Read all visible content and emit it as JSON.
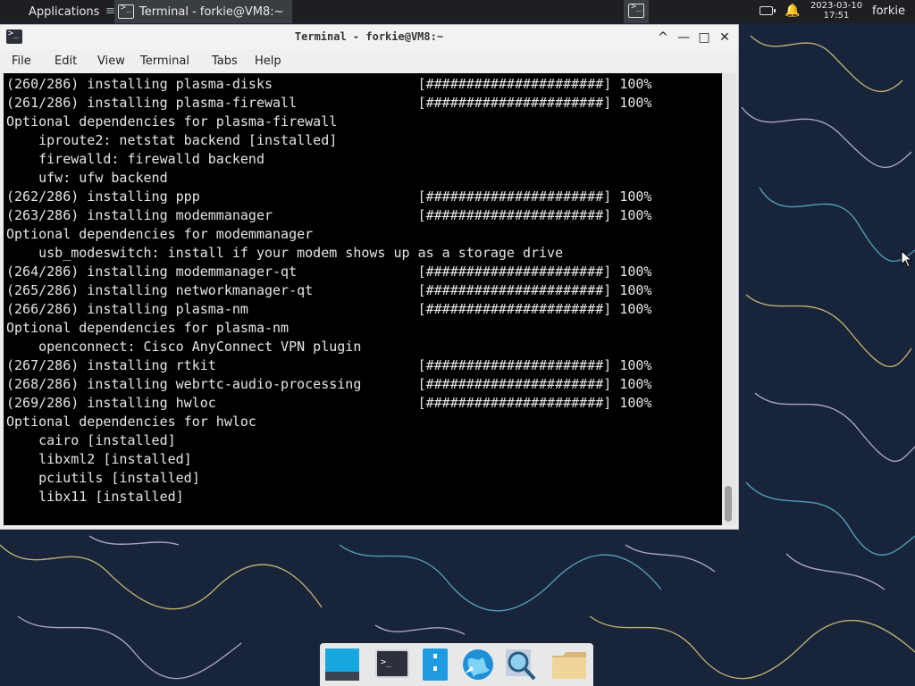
{
  "panel": {
    "applications_label": "Applications",
    "separator": "≡",
    "task_title": "Terminal - forkie@VM8:~",
    "clock_date": "2023-03-10",
    "clock_time": "17:51",
    "user": "forkie"
  },
  "window": {
    "title": "Terminal - forkie@VM8:~",
    "controls": {
      "shade": "^",
      "minimize": "—",
      "maximize": "□",
      "close": "✕"
    },
    "menu": [
      "File",
      "Edit",
      "View",
      "Terminal",
      "Tabs",
      "Help"
    ]
  },
  "terminal": {
    "lines": [
      "(260/286) installing plasma-disks                  [######################] 100%",
      "(261/286) installing plasma-firewall               [######################] 100%",
      "Optional dependencies for plasma-firewall",
      "    iproute2: netstat backend [installed]",
      "    firewalld: firewalld backend",
      "    ufw: ufw backend",
      "(262/286) installing ppp                           [######################] 100%",
      "(263/286) installing modemmanager                  [######################] 100%",
      "Optional dependencies for modemmanager",
      "    usb_modeswitch: install if your modem shows up as a storage drive",
      "(264/286) installing modemmanager-qt               [######################] 100%",
      "(265/286) installing networkmanager-qt             [######################] 100%",
      "(266/286) installing plasma-nm                     [######################] 100%",
      "Optional dependencies for plasma-nm",
      "    openconnect: Cisco AnyConnect VPN plugin",
      "(267/286) installing rtkit                         [######################] 100%",
      "(268/286) installing webrtc-audio-processing       [######################] 100%",
      "(269/286) installing hwloc                         [######################] 100%",
      "Optional dependencies for hwloc",
      "    cairo [installed]",
      "    libxml2 [installed]",
      "    pciutils [installed]",
      "    libx11 [installed]"
    ]
  },
  "dock": {
    "items": [
      "show-desktop-icon",
      "terminal-icon",
      "file-manager-icon",
      "web-browser-icon",
      "app-finder-icon",
      "folder-icon"
    ]
  },
  "colors": {
    "panel_bg": "#1d1f22",
    "wallpaper_bg": "#17243a",
    "terminal_bg": "#000000",
    "terminal_fg": "#e6e6e6"
  }
}
